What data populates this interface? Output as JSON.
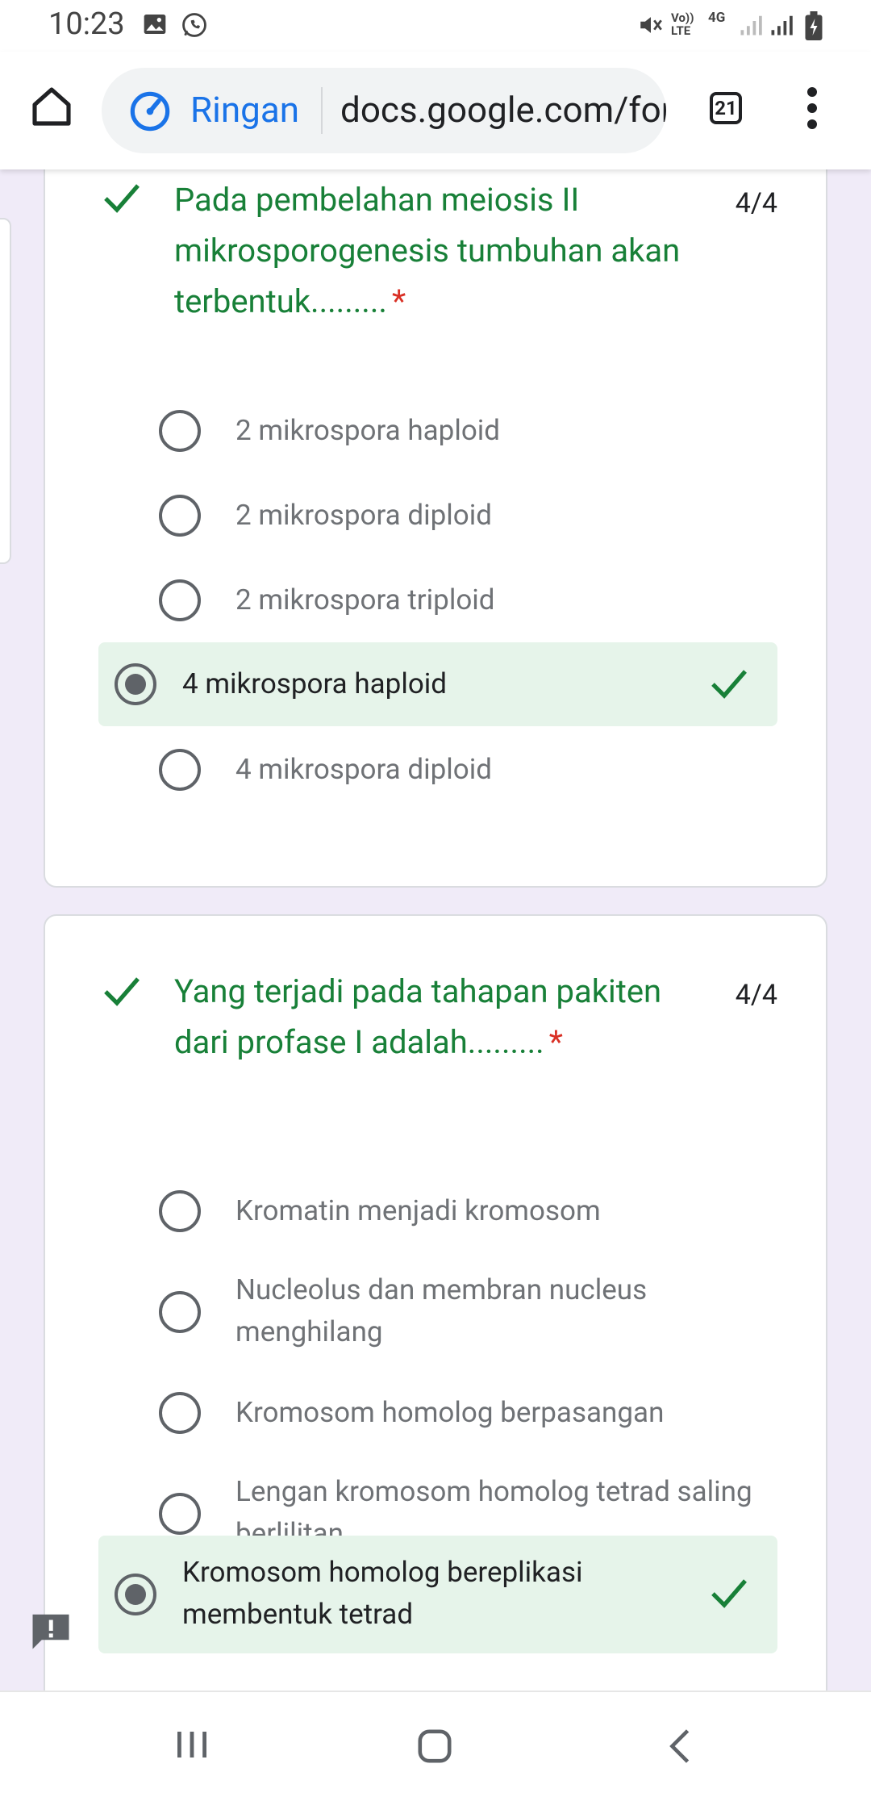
{
  "status_bar": {
    "time": "10:23",
    "icons": [
      "image-icon",
      "whatsapp-icon",
      "mute-icon",
      "volte-icon",
      "4g-icon",
      "signal-icon",
      "signal-icon",
      "battery-charging-icon"
    ],
    "volte_text": "Vo)) LTE",
    "network_text": "4G"
  },
  "browser": {
    "lite_label": "Ringan",
    "url": "docs.google.com/forms",
    "tab_count": "21"
  },
  "questions": [
    {
      "title": "Pada pembelahan meiosis II mikrosporogenesis tumbuhan akan terbentuk.........",
      "required_mark": "*",
      "score": "4/4",
      "options": [
        {
          "label": "2 mikrospora haploid",
          "selected": false
        },
        {
          "label": "2 mikrospora diploid",
          "selected": false
        },
        {
          "label": "2 mikrospora triploid",
          "selected": false
        },
        {
          "label": "4 mikrospora haploid",
          "selected": true
        },
        {
          "label": "4 mikrospora diploid",
          "selected": false
        }
      ]
    },
    {
      "title": "Yang terjadi pada tahapan pakiten dari profase I adalah.........",
      "required_mark": "*",
      "score": "4/4",
      "options": [
        {
          "label": "Kromatin menjadi kromosom",
          "selected": false
        },
        {
          "label": "Nucleolus dan membran nucleus menghilang",
          "selected": false
        },
        {
          "label": "Kromosom homolog berpasangan",
          "selected": false
        },
        {
          "label": "Lengan kromosom homolog tetrad saling berlilitan",
          "selected": false
        },
        {
          "label": "Kromosom homolog bereplikasi membentuk tetrad",
          "selected": true
        }
      ]
    }
  ],
  "colors": {
    "correct_green": "#188038",
    "selected_bg": "#e6f4ea",
    "page_bg": "#f0ebf8",
    "lite_blue": "#1a73e8",
    "required_red": "#d93025"
  }
}
